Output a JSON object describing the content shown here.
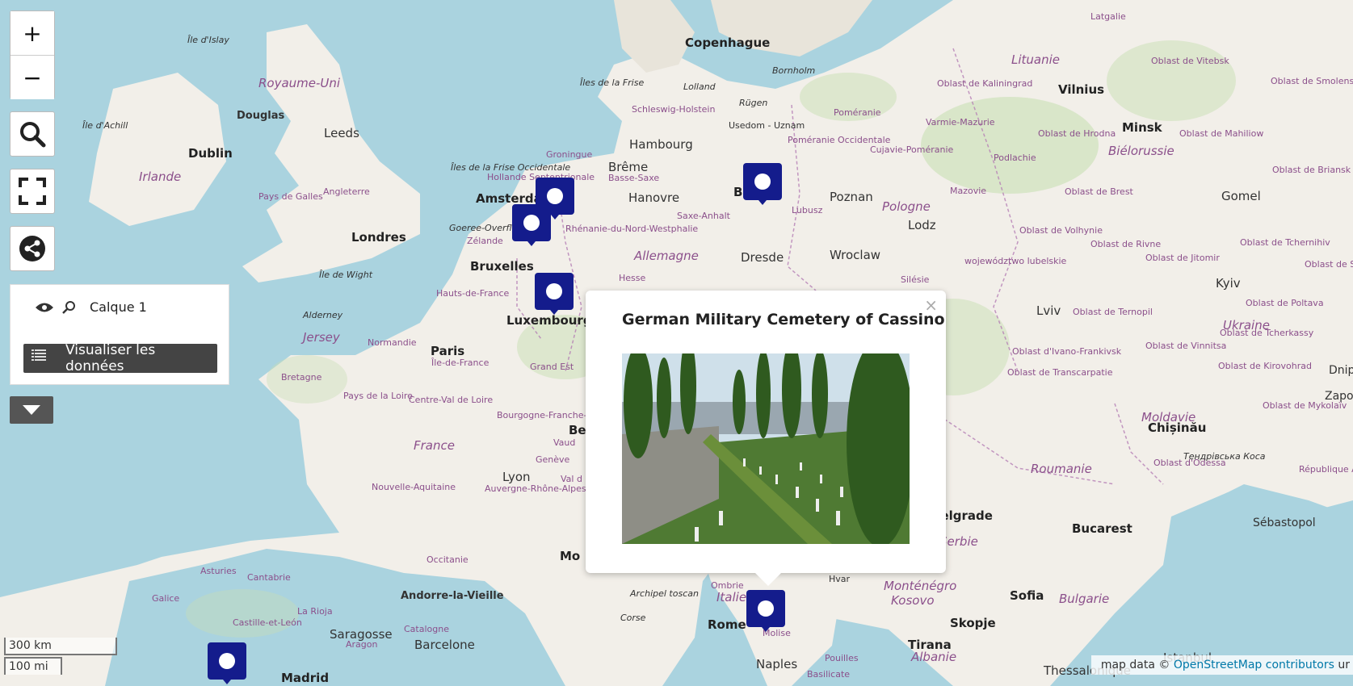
{
  "controls": {
    "zoom_in": "+",
    "zoom_out": "−",
    "search_icon": "search-icon",
    "fullscreen_icon": "fullscreen-icon",
    "share_icon": "share-icon",
    "dropdown_icon": "chevron-down-icon"
  },
  "layers_panel": {
    "layer_name": "Calque 1",
    "view_data_label": "Visualiser les données"
  },
  "popup": {
    "title": "German Military Cemetery of Cassino",
    "close": "×"
  },
  "scale": {
    "metric": "300 km",
    "imperial": "100 mi"
  },
  "attribution": {
    "prefix": "map data © ",
    "link": "OpenStreetMap contributors",
    "suffix": " ur"
  },
  "colors": {
    "water": "#aad3df",
    "land": "#f2efe9",
    "forest": "#c8dfb4",
    "marker": "#141c8c",
    "country_label": "#8b4f8b"
  },
  "map_labels": {
    "cities": [
      "Copenhague",
      "Vilnius",
      "Minsk",
      "Dublin",
      "Douglas",
      "Leeds",
      "Londres",
      "Amsterdam",
      "Bruxelles",
      "Hambourg",
      "Brême",
      "Hanovre",
      "Berlin",
      "Poznan",
      "Lodz",
      "Dresde",
      "Wroclaw",
      "Paris",
      "Luxembourg",
      "Gomel",
      "Kyiv",
      "Lviv",
      "Chișinău",
      "Bucarest",
      "Sofia",
      "Skopje",
      "Tirana",
      "Rome",
      "Naples",
      "Madrid",
      "Barcelone",
      "Saragosse",
      "Sébastopol",
      "Istanbul",
      "Thessalonique",
      "Lyon",
      "Andorre-la-Vieille",
      "Belgrade",
      "Be",
      "Mo"
    ],
    "countries": [
      "Royaume-Uni",
      "Irlande",
      "Lituanie",
      "Biélorussie",
      "Pologne",
      "Allemagne",
      "France",
      "Ukraine",
      "Moldavie",
      "Roumanie",
      "Bulgarie",
      "Monténégro",
      "Kosovo",
      "Albanie",
      "Italie",
      "Serbie",
      "Jersey"
    ],
    "regions": [
      "Latgalie",
      "Oblast de Vitebsk",
      "Oblast de Smolensk",
      "Oblast de Kaliningrad",
      "Oblast de Hrodna",
      "Oblast de Mahiliow",
      "Oblast de Briansk",
      "Varmie-Mazurie",
      "Podlachie",
      "Poméranie",
      "Poméranie Occidentale",
      "Cujavie-Poméranie",
      "Mazovie",
      "Oblast de Brest",
      "Oblast de Volhynie",
      "Oblast de Rivne",
      "Oblast de Jitomir",
      "Oblast de Tchernihiv",
      "Oblast de Soumy",
      "Oblast de Poltava",
      "Lubusz",
      "Saxe-Anhalt",
      "Basse-Saxe",
      "Schleswig-Holstein",
      "Hollande Septentrionale",
      "Zélande",
      "Rhénanie-du-Nord-Westphalie",
      "Hesse",
      "Silésie",
      "województwo lubelskie",
      "Oblast de Ternopil",
      "Oblast d'Ivano-Frankivsk",
      "Oblast de Transcarpatie",
      "Oblast de Vinnitsa",
      "Oblast de Tcherkassy",
      "Oblast de Kirovohrad",
      "Oblast de Mykolaïv",
      "Oblast d'Odessa",
      "Тендрівська Коса",
      "République Autonome de Crimée",
      "Pays de Galles",
      "Angleterre",
      "Hauts-de-France",
      "Île-de-France",
      "Grand Est",
      "Normandie",
      "Bretagne",
      "Pays de la Loire",
      "Centre-Val de Loire",
      "Bourgogne-Franche-Comté",
      "Nouvelle-Aquitaine",
      "Auvergne-Rhône-Alpes",
      "Occitanie",
      "Asturies",
      "Cantabrie",
      "Galice",
      "Castille-et-León",
      "La Rioja",
      "Aragon",
      "Catalogne",
      "Groningue",
      "Ombrie",
      "Molise",
      "Pouilles",
      "Basilicate",
      "Hvar",
      "Vaud",
      "Genève",
      "Val d",
      "Usedom - Uznam",
      "Dnip",
      "Zapo"
    ],
    "islands": [
      "Île d'Islay",
      "Île d'Achill",
      "Îles de la Frise",
      "Lolland",
      "Bornholm",
      "Rügen",
      "Îles de la Frise Occidentale",
      "Goeree-Overflakkee",
      "Île de Wight",
      "Alderney",
      "Archipel toscan",
      "Corse"
    ]
  }
}
